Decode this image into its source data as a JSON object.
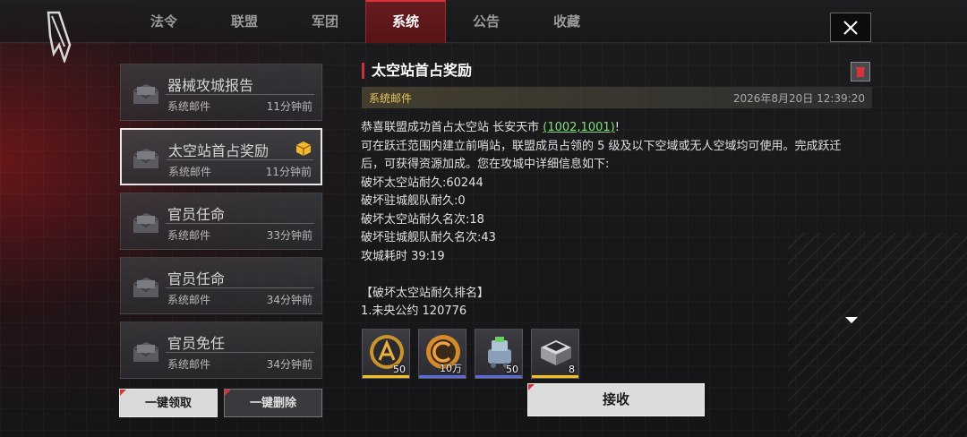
{
  "tabs": [
    {
      "label": "法令",
      "active": false
    },
    {
      "label": "联盟",
      "active": false
    },
    {
      "label": "军团",
      "active": false
    },
    {
      "label": "系统",
      "active": true
    },
    {
      "label": "公告",
      "active": false
    },
    {
      "label": "收藏",
      "active": false
    }
  ],
  "close_icon": "close-x",
  "mails": [
    {
      "title": "器械攻城报告",
      "sender": "系统邮件",
      "time": "11分钟前",
      "selected": false,
      "has_attachment": false
    },
    {
      "title": "太空站首占奖励",
      "sender": "系统邮件",
      "time": "11分钟前",
      "selected": true,
      "has_attachment": true
    },
    {
      "title": "官员任命",
      "sender": "系统邮件",
      "time": "33分钟前",
      "selected": false,
      "has_attachment": false
    },
    {
      "title": "官员任命",
      "sender": "系统邮件",
      "time": "34分钟前",
      "selected": false,
      "has_attachment": false
    },
    {
      "title": "官员免任",
      "sender": "系统邮件",
      "time": "34分钟前",
      "selected": false,
      "has_attachment": false
    }
  ],
  "buttons": {
    "claim_all": "一键领取",
    "delete_all": "一键删除",
    "claim": "接收"
  },
  "detail": {
    "title": "太空站首占奖励",
    "sender": "系统邮件",
    "date": "2026年8月20日 12:39:20",
    "lines": {
      "l1_prefix": "恭喜联盟成功首占太空站 长安天市 ",
      "l1_coord": "(1002,1001)",
      "l1_suffix": "!",
      "l2": "可在跃迁范围内建立前哨站，联盟成员占领的 5 级及以下空域或无人空域均可使用。完成跃迁",
      "l3": "后，可获得资源加成。您在攻城中详细信息如下:",
      "l4": "破坏太空站耐久:60244",
      "l5": "破坏驻城舰队耐久:0",
      "l6": "破坏太空站耐久名次:18",
      "l7": "破坏驻城舰队耐久名次:43",
      "l8": "攻城耗时 39:19",
      "l9": "",
      "l10": "【破坏太空站耐久排名】",
      "l11": "1.未央公约 120776"
    }
  },
  "rewards": [
    {
      "icon": "alliance-coin-icon",
      "qty": "50",
      "rarity_color": "#f0c020"
    },
    {
      "icon": "credit-coin-icon",
      "qty": "10万",
      "rarity_color": "#5a6ad8"
    },
    {
      "icon": "robot-unit-icon",
      "qty": "50",
      "rarity_color": "#5a6ad8"
    },
    {
      "icon": "supply-crate-icon",
      "qty": "8",
      "rarity_color": "#f0c020"
    }
  ],
  "colors": {
    "accent_red": "#d8323a",
    "coord_green": "#7fe07a",
    "sender_gold": "#e8c65a"
  }
}
